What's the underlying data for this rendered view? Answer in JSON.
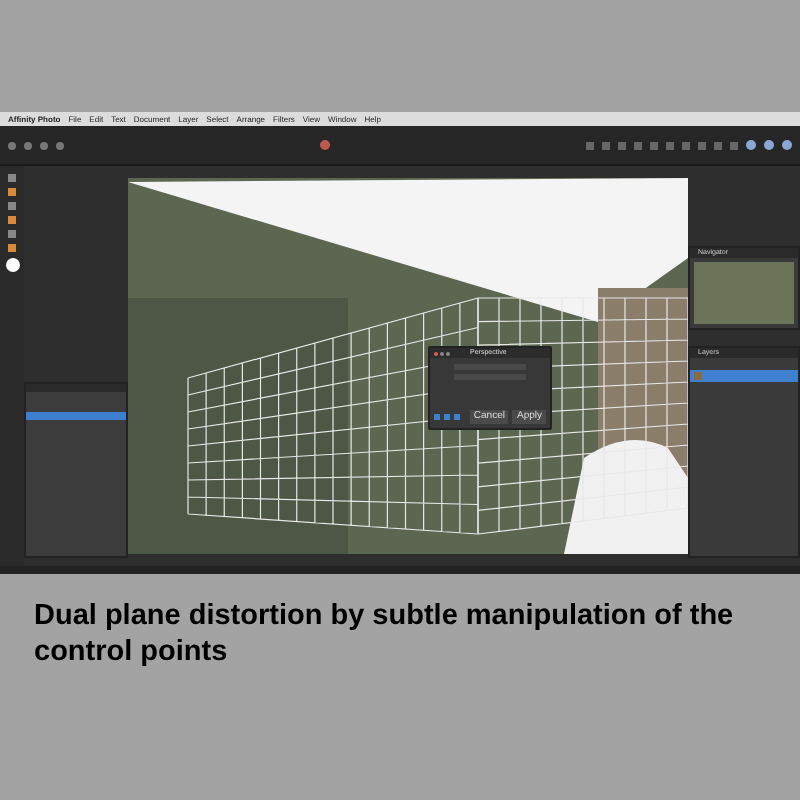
{
  "menu_bar": {
    "items": [
      "Affinity Photo",
      "File",
      "Edit",
      "Text",
      "Document",
      "Layer",
      "Select",
      "Arrange",
      "Filters",
      "View",
      "Window",
      "Help"
    ]
  },
  "dialog": {
    "title": "Perspective",
    "buttons": [
      "Cancel",
      "Apply"
    ]
  },
  "panels": [
    {
      "title": "Navigator"
    },
    {
      "title": "Layers"
    }
  ],
  "caption": "Dual plane distortion by subtle manipulation of the control points"
}
